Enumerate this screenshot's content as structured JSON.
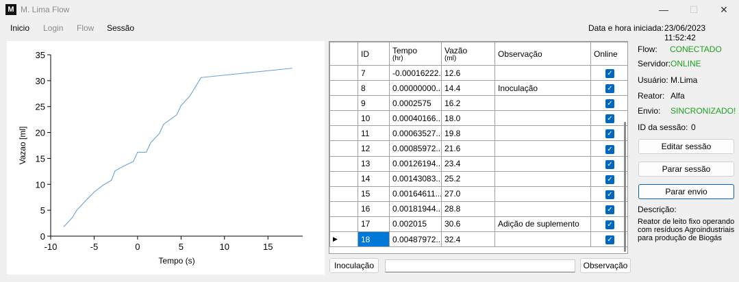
{
  "window": {
    "icon_text": "M",
    "title": "M. Lima Flow",
    "minimize": "—",
    "maximize": "☐",
    "close": "✕"
  },
  "menu": {
    "inicio": "Inicio",
    "login": "Login",
    "flow": "Flow",
    "sessao": "Sessão"
  },
  "header": {
    "started_label": "Data e hora iniciada:",
    "started_value": "23/06/2023 11:52:42"
  },
  "grid": {
    "columns": [
      "ID",
      "Tempo",
      "(hr)",
      "Vazão",
      "(ml)",
      "Observação",
      "Online"
    ],
    "rows": [
      {
        "id": "7",
        "tempo": "-0.00016222...",
        "vazao": "12.6",
        "obs": "",
        "online": true
      },
      {
        "id": "8",
        "tempo": "0.00000000...",
        "vazao": "14.4",
        "obs": "Inoculação",
        "online": true
      },
      {
        "id": "9",
        "tempo": "0.0002575",
        "vazao": "16.2",
        "obs": "",
        "online": true
      },
      {
        "id": "10",
        "tempo": "0.00040166...",
        "vazao": "18.0",
        "obs": "",
        "online": true
      },
      {
        "id": "11",
        "tempo": "0.00063527...",
        "vazao": "19.8",
        "obs": "",
        "online": true
      },
      {
        "id": "12",
        "tempo": "0.00085972...",
        "vazao": "21.6",
        "obs": "",
        "online": true
      },
      {
        "id": "13",
        "tempo": "0.00126194...",
        "vazao": "23.4",
        "obs": "",
        "online": true
      },
      {
        "id": "14",
        "tempo": "0.00143083...",
        "vazao": "25.2",
        "obs": "",
        "online": true
      },
      {
        "id": "15",
        "tempo": "0.00164611...",
        "vazao": "27.0",
        "obs": "",
        "online": true
      },
      {
        "id": "16",
        "tempo": "0.00181944...",
        "vazao": "28.8",
        "obs": "",
        "online": true
      },
      {
        "id": "17",
        "tempo": "0.002015",
        "vazao": "30.6",
        "obs": "Adição de suplemento",
        "online": true
      },
      {
        "id": "18",
        "tempo": "0.00487972...",
        "vazao": "32.4",
        "obs": "",
        "online": true,
        "current": true
      }
    ],
    "current_row_marker": "▶"
  },
  "bottom": {
    "inoculacao_button": "Inoculação",
    "observacao_value": "",
    "observacao_button": "Observação"
  },
  "status": {
    "flow_label": "Flow:",
    "flow_value": "CONECTADO",
    "servidor_label": "Servidor:",
    "servidor_value": "ONLINE",
    "usuario_label": "Usuário:",
    "usuario_value": "M.Lima",
    "reator_label": "Reator:",
    "reator_value": "Alfa",
    "envio_label": "Envio:",
    "envio_value": "SINCRONIZADO!",
    "sessao_id_label": "ID da sessão:",
    "sessao_id_value": "0",
    "ok_color": "#1aa31a"
  },
  "actions": {
    "editar": "Editar sessão",
    "parar_sessao": "Parar sessão",
    "parar_envio": "Parar envio"
  },
  "descricao": {
    "label": "Descrição:",
    "text": "Reator de leito fixo operando com resíduos Agroindustriais para produção de Biogás"
  },
  "chart_data": {
    "type": "line",
    "xlabel": "Tempo (s)",
    "ylabel": "Vazao [ml]",
    "xlim": [
      -10,
      19
    ],
    "ylim": [
      0,
      35
    ],
    "xticks": [
      -10,
      -5,
      0,
      5,
      10,
      15
    ],
    "yticks": [
      0,
      5,
      10,
      15,
      20,
      25,
      30,
      35
    ],
    "line_color": "#5b9bd5",
    "series": [
      {
        "x": [
          -8.5,
          -7.5,
          -7,
          -6,
          -5,
          -4,
          -3,
          -2.6,
          -1.5,
          -0.5,
          0,
          1,
          1.5,
          2.5,
          3,
          4.5,
          5,
          6,
          7.3,
          17.8
        ],
        "y": [
          1.8,
          3.6,
          5.0,
          6.8,
          8.5,
          9.8,
          10.8,
          12.6,
          13.6,
          14.4,
          16.2,
          16.2,
          18.0,
          19.8,
          21.6,
          23.4,
          25.2,
          27.0,
          30.6,
          32.4
        ]
      }
    ]
  }
}
